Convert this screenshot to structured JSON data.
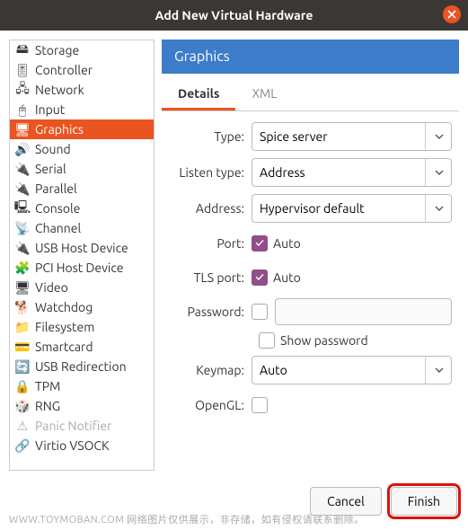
{
  "window": {
    "title": "Add New Virtual Hardware"
  },
  "sidebar": {
    "items": [
      {
        "label": "Storage",
        "icon": "storage"
      },
      {
        "label": "Controller",
        "icon": "controller"
      },
      {
        "label": "Network",
        "icon": "network"
      },
      {
        "label": "Input",
        "icon": "input"
      },
      {
        "label": "Graphics",
        "icon": "graphics",
        "selected": true
      },
      {
        "label": "Sound",
        "icon": "sound"
      },
      {
        "label": "Serial",
        "icon": "serial"
      },
      {
        "label": "Parallel",
        "icon": "parallel"
      },
      {
        "label": "Console",
        "icon": "console"
      },
      {
        "label": "Channel",
        "icon": "channel"
      },
      {
        "label": "USB Host Device",
        "icon": "usb"
      },
      {
        "label": "PCI Host Device",
        "icon": "pci"
      },
      {
        "label": "Video",
        "icon": "video"
      },
      {
        "label": "Watchdog",
        "icon": "watchdog"
      },
      {
        "label": "Filesystem",
        "icon": "filesystem"
      },
      {
        "label": "Smartcard",
        "icon": "smartcard"
      },
      {
        "label": "USB Redirection",
        "icon": "usbredir"
      },
      {
        "label": "TPM",
        "icon": "tpm"
      },
      {
        "label": "RNG",
        "icon": "rng"
      },
      {
        "label": "Panic Notifier",
        "icon": "panic",
        "disabled": true
      },
      {
        "label": "Virtio VSOCK",
        "icon": "vsock"
      }
    ]
  },
  "panel": {
    "header": "Graphics",
    "tabs": {
      "details": "Details",
      "xml": "XML",
      "active": "details"
    },
    "form": {
      "type_label": "Type:",
      "type_value": "Spice server",
      "listen_label": "Listen type:",
      "listen_value": "Address",
      "address_label": "Address:",
      "address_value": "Hypervisor default",
      "port_label": "Port:",
      "port_auto_label": "Auto",
      "port_auto": true,
      "tlsport_label": "TLS port:",
      "tlsport_auto_label": "Auto",
      "tlsport_auto": true,
      "password_label": "Password:",
      "password_enabled": false,
      "showpw_label": "Show password",
      "showpw_checked": false,
      "keymap_label": "Keymap:",
      "keymap_value": "Auto",
      "opengl_label": "OpenGL:",
      "opengl_checked": false
    }
  },
  "buttons": {
    "cancel": "Cancel",
    "finish": "Finish"
  },
  "watermark": "WWW.TOYMOBAN.COM  网络图片仅供展示，非存储，如有侵权请联系删除。"
}
